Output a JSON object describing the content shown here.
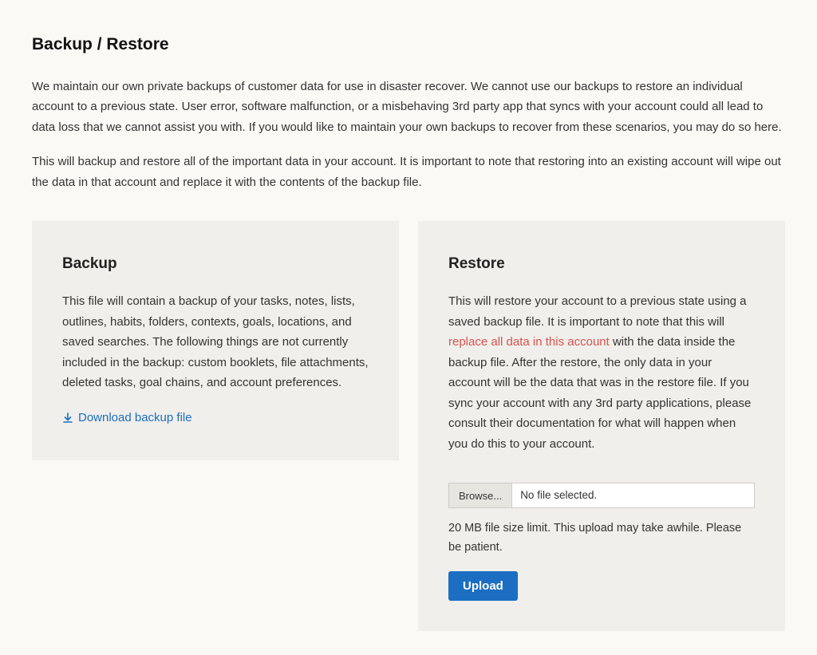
{
  "page": {
    "title": "Backup / Restore",
    "intro1": "We maintain our own private backups of customer data for use in disaster recover. We cannot use our backups to restore an individual account to a previous state. User error, software malfunction, or a misbehaving 3rd party app that syncs with your account could all lead to data loss that we cannot assist you with. If you would like to maintain your own backups to recover from these scenarios, you may do so here.",
    "intro2": "This will backup and restore all of the important data in your account. It is important to note that restoring into an existing account will wipe out the data in that account and replace it with the contents of the backup file."
  },
  "backup": {
    "heading": "Backup",
    "body": "This file will contain a backup of your tasks, notes, lists, outlines, habits, folders, contexts, goals, locations, and saved searches. The following things are not currently included in the backup: custom booklets, file attachments, deleted tasks, goal chains, and account preferences.",
    "download_label": "Download backup file"
  },
  "restore": {
    "heading": "Restore",
    "body_pre": "This will restore your account to a previous state using a saved backup file. It is important to note that this will ",
    "body_warn": "replace all data in this account",
    "body_post": " with the data inside the backup file. After the restore, the only data in your account will be the data that was in the restore file. If you sync your account with any 3rd party applications, please consult their documentation for what will happen when you do this to your account.",
    "browse_label": "Browse...",
    "file_status": "No file selected.",
    "hint": "20 MB file size limit. This upload may take awhile. Please be patient.",
    "upload_label": "Upload"
  }
}
